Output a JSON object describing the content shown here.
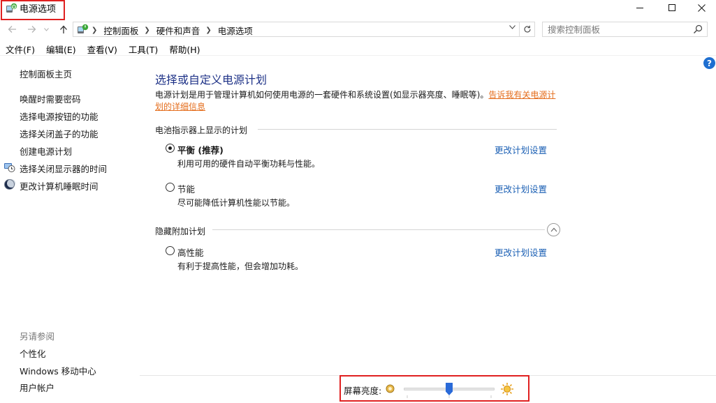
{
  "window": {
    "title": "电源选项",
    "controls": {
      "minimize": "—",
      "maximize": "☐",
      "close": "✕"
    }
  },
  "address": {
    "crumbs": [
      "控制面板",
      "硬件和声音",
      "电源选项"
    ],
    "search_placeholder": "搜索控制面板"
  },
  "menu": [
    "文件(F)",
    "编辑(E)",
    "查看(V)",
    "工具(T)",
    "帮助(H)"
  ],
  "help_label": "?",
  "sidebar": {
    "home": "控制面板主页",
    "items": [
      {
        "label": "唤醒时需要密码",
        "icon": ""
      },
      {
        "label": "选择电源按钮的功能",
        "icon": ""
      },
      {
        "label": "选择关闭盖子的功能",
        "icon": ""
      },
      {
        "label": "创建电源计划",
        "icon": ""
      },
      {
        "label": "选择关闭显示器的时间",
        "icon": "monitor-clock-icon"
      },
      {
        "label": "更改计算机睡眠时间",
        "icon": "moon-icon"
      }
    ],
    "see_also_title": "另请参阅",
    "see_also": [
      "个性化",
      "Windows 移动中心",
      "用户帐户"
    ]
  },
  "main": {
    "title": "选择或自定义电源计划",
    "description": "电源计划是用于管理计算机如何使用电源的一套硬件和系统设置(如显示器亮度、睡眠等)。",
    "description_link_1": "告诉我有关电源计",
    "description_link_2": "划的详细信息",
    "section_battery": "电池指示器上显示的计划",
    "section_hidden": "隐藏附加计划",
    "plans": [
      {
        "name": "平衡 (推荐)",
        "description": "利用可用的硬件自动平衡功耗与性能。",
        "selected": true,
        "change_link": "更改计划设置"
      },
      {
        "name": "节能",
        "description": "尽可能降低计算机性能以节能。",
        "selected": false,
        "change_link": "更改计划设置"
      },
      {
        "name": "高性能",
        "description": "有利于提高性能，但会增加功耗。",
        "selected": false,
        "change_link": "更改计划设置"
      }
    ]
  },
  "brightness": {
    "label": "屏幕亮度:",
    "value_fraction": 0.5
  },
  "colors": {
    "title_blue": "#1e3287",
    "link_blue": "#1a5fb4",
    "link_orange": "#e46d1c",
    "highlight_red": "#e02020",
    "slider_thumb": "#2a6ad8"
  }
}
